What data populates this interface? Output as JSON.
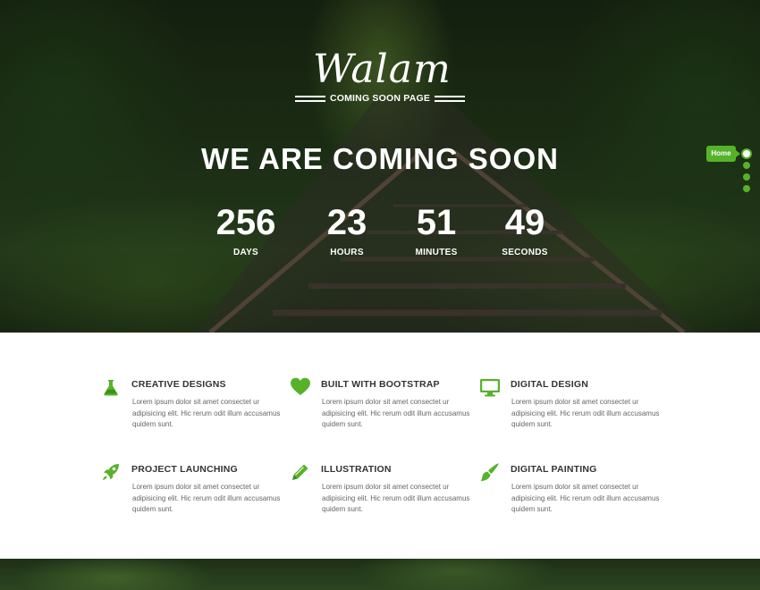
{
  "brand": {
    "logo_script": "Walam",
    "logo_subtitle": "COMING SOON PAGE"
  },
  "hero": {
    "headline": "WE ARE COMING SOON",
    "countdown": [
      {
        "value": "256",
        "label": "DAYS"
      },
      {
        "value": "23",
        "label": "HOURS"
      },
      {
        "value": "51",
        "label": "MINUTES"
      },
      {
        "value": "49",
        "label": "SECONDS"
      }
    ]
  },
  "dot_nav": {
    "tooltip": "Home",
    "count": 4,
    "active_index": 0
  },
  "colors": {
    "accent": "#56b22b",
    "heading": "#333333",
    "body_text": "#666666"
  },
  "features": [
    {
      "icon": "flask-icon",
      "title": "CREATIVE DESIGNS",
      "desc": "Lorem ipsum dolor sit amet consectet ur adipisicing elit. Hic rerum odit illum accusamus quidem sunt."
    },
    {
      "icon": "heart-icon",
      "title": "BUILT WITH BOOTSTRAP",
      "desc": "Lorem ipsum dolor sit amet consectet ur adipisicing elit. Hic rerum odit illum accusamus quidem sunt."
    },
    {
      "icon": "monitor-icon",
      "title": "DIGITAL DESIGN",
      "desc": "Lorem ipsum dolor sit amet consectet ur adipisicing elit. Hic rerum odit illum accusamus quidem sunt."
    },
    {
      "icon": "rocket-icon",
      "title": "PROJECT LAUNCHING",
      "desc": "Lorem ipsum dolor sit amet consectet ur adipisicing elit. Hic rerum odit illum accusamus quidem sunt."
    },
    {
      "icon": "pencil-icon",
      "title": "ILLUSTRATION",
      "desc": "Lorem ipsum dolor sit amet consectet ur adipisicing elit. Hic rerum odit illum accusamus quidem sunt."
    },
    {
      "icon": "paintbrush-icon",
      "title": "DIGITAL PAINTING",
      "desc": "Lorem ipsum dolor sit amet consectet ur adipisicing elit. Hic rerum odit illum accusamus quidem sunt."
    }
  ]
}
